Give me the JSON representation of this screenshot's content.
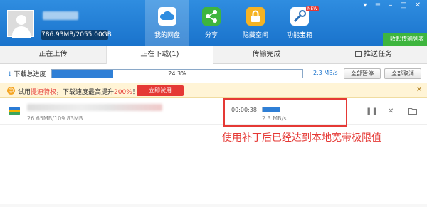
{
  "header": {
    "quota": "786.93MB/2055.00GB",
    "nav": [
      {
        "label": "我的网盘",
        "icon": "cloud-icon",
        "color": "#7ec0ff"
      },
      {
        "label": "分享",
        "icon": "share-icon",
        "color": "#3eb53e"
      },
      {
        "label": "隐藏空间",
        "icon": "lock-icon",
        "color": "#f5b323"
      },
      {
        "label": "功能宝箱",
        "icon": "toolbox-icon",
        "color": "#2a6fb8",
        "badge": "NEW"
      }
    ],
    "guide_button": "收起传输列表"
  },
  "tabs": [
    {
      "label": "正在上传"
    },
    {
      "label": "正在下载(1)",
      "active": true
    },
    {
      "label": "传输完成"
    },
    {
      "label": "推送任务"
    }
  ],
  "total": {
    "label": "下载总进度",
    "percent_text": "24.3%",
    "percent": 24.3,
    "speed": "2.3 MB/s",
    "pause_all": "全部暂停",
    "cancel_all": "全部取消"
  },
  "promo": {
    "text_prefix": "试用",
    "text_highlight1": "提速特权",
    "text_middle": "，下载速度最高提升",
    "text_highlight2": "200%",
    "text_suffix": "！",
    "button": "立即试用"
  },
  "item": {
    "size": "26.65MB/109.83MB",
    "time_left": "00:00:38",
    "speed": "2.3 MB/s",
    "progress": 24.3
  },
  "annotation": "使用补丁后已经达到本地宽带极限值"
}
